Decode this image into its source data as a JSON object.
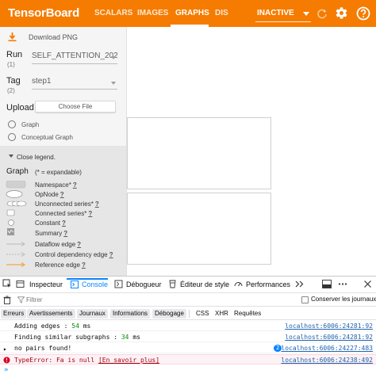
{
  "header": {
    "brand": "TensorBoard",
    "tabs": [
      "SCALARS",
      "IMAGES",
      "GRAPHS",
      "DIS"
    ],
    "active_tab": "GRAPHS",
    "status_select": "INACTIVE",
    "accent": "#f57c00"
  },
  "sidebar": {
    "download_label": "Download PNG",
    "run_label": "Run",
    "run_count": "(1)",
    "run_value": "SELF_ATTENTION_202",
    "tag_label": "Tag",
    "tag_count": "(2)",
    "tag_value": "step1",
    "upload_label": "Upload",
    "choose_file": "Choose File",
    "graph_types": [
      "Graph",
      "Conceptual Graph"
    ],
    "close_legend": "Close legend.",
    "legend_title": "Graph",
    "legend_hint": "(* = expandable)",
    "legend_items": [
      {
        "label": "Namespace*",
        "q": "?"
      },
      {
        "label": "OpNode",
        "q": "?"
      },
      {
        "label": "Unconnected series*",
        "q": "?"
      },
      {
        "label": "Connected series*",
        "q": "?"
      },
      {
        "label": "Constant",
        "q": "?"
      },
      {
        "label": "Summary",
        "q": "?"
      },
      {
        "label": "Dataflow edge",
        "q": "?"
      },
      {
        "label": "Control dependency edge",
        "q": "?"
      },
      {
        "label": "Reference edge",
        "q": "?"
      }
    ]
  },
  "devtools": {
    "tabs": [
      "Inspecteur",
      "Console",
      "Débogueur",
      "Éditeur de style",
      "Performances"
    ],
    "active_tab": "Console",
    "filter_placeholder": "Filtrer",
    "persist_logs": "Conserver les journaux",
    "categories": [
      "Erreurs",
      "Avertissements",
      "Journaux",
      "Informations",
      "Débogage",
      "CSS",
      "XHR",
      "Requêtes"
    ],
    "logs": [
      {
        "text": "Adding edges : ",
        "value": "54",
        "unit": " ms",
        "source": "localhost:6006:24281:92"
      },
      {
        "text": "Finding similar subgraphs : ",
        "value": "34",
        "unit": " ms",
        "source": "localhost:6006:24281:92"
      },
      {
        "text": "no pairs found!",
        "badge": "2",
        "source": "localhost:6006:24227:483"
      },
      {
        "text": "TypeError: Fa is null ",
        "link": "[En savoir plus]",
        "source": "localhost:6006:24238:492"
      }
    ]
  }
}
